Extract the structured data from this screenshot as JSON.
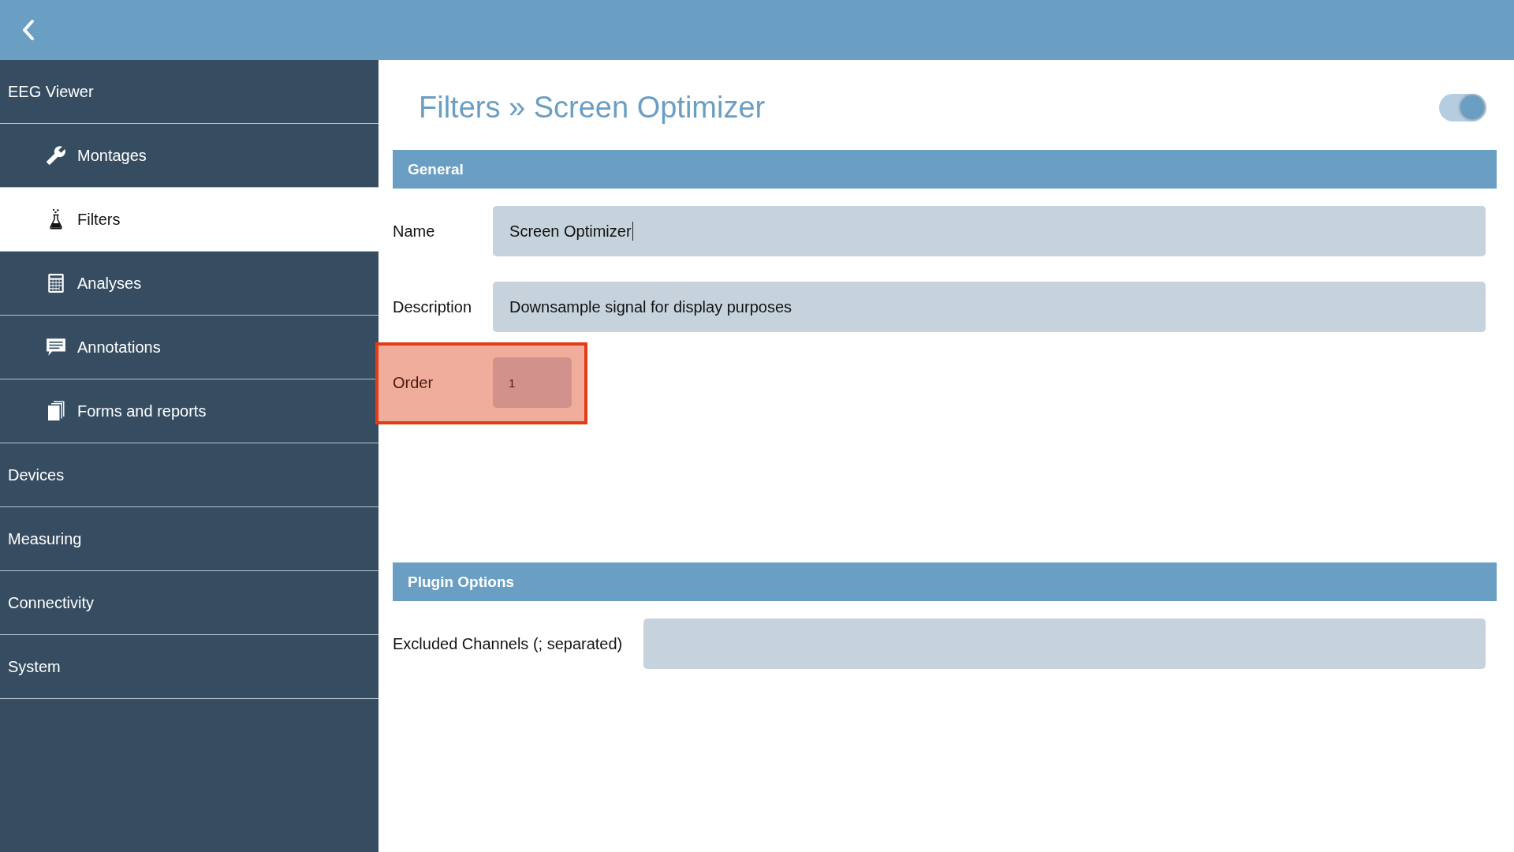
{
  "sidebar": {
    "items": [
      {
        "label": "EEG Viewer",
        "selected": false,
        "children": [
          {
            "label": "Montages",
            "selected": false
          },
          {
            "label": "Filters",
            "selected": true
          },
          {
            "label": "Analyses",
            "selected": false
          },
          {
            "label": "Annotations",
            "selected": false
          },
          {
            "label": "Forms and reports",
            "selected": false
          }
        ]
      },
      {
        "label": "Devices",
        "selected": false
      },
      {
        "label": "Measuring",
        "selected": false
      },
      {
        "label": "Connectivity",
        "selected": false
      },
      {
        "label": "System",
        "selected": false
      }
    ]
  },
  "page": {
    "title": "Filters » Screen Optimizer",
    "enabled": true
  },
  "sections": [
    {
      "title": "General",
      "fields": [
        {
          "label": "Name",
          "kind": "text",
          "value": "Screen Optimizer",
          "focused": true,
          "highlighted": false
        },
        {
          "label": "Description",
          "kind": "text",
          "value": "Downsample signal for display purposes",
          "focused": false,
          "highlighted": false
        },
        {
          "label": "Order",
          "kind": "number",
          "value": "1",
          "focused": false,
          "highlighted": true
        }
      ]
    },
    {
      "title": "Plugin Options",
      "fields": [
        {
          "label": "Excluded Channels (; separated)",
          "kind": "text",
          "focused": false,
          "highlighted": false
        }
      ]
    }
  ]
}
